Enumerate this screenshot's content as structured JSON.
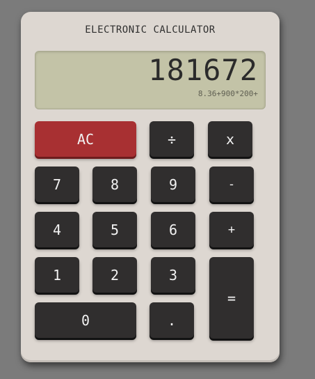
{
  "calculator": {
    "title": "ELECTRONIC CALCULATOR",
    "display": {
      "value": "181672",
      "expression": "8.36+900*200+"
    },
    "keys": {
      "ac": "AC",
      "divide": "÷",
      "multiply": "x",
      "seven": "7",
      "eight": "8",
      "nine": "9",
      "minus": "-",
      "four": "4",
      "five": "5",
      "six": "6",
      "plus": "+",
      "one": "1",
      "two": "2",
      "three": "3",
      "equals": "=",
      "zero": "0",
      "decimal": "."
    }
  },
  "colors": {
    "body": "#ddd7d1",
    "display": "#c3c3a7",
    "key": "#302e2e",
    "clear_key": "#a83032",
    "background": "#7b7b7b"
  }
}
